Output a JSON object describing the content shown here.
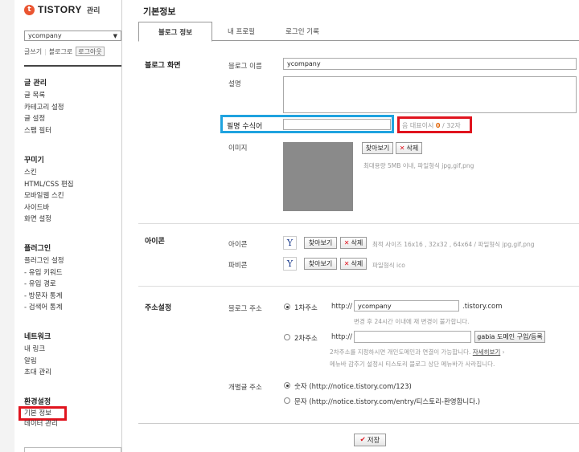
{
  "sidebar": {
    "logo_mark": "t",
    "logo_text": "TISTORY",
    "logo_sub": "관리",
    "blog_select": "ycompany",
    "quick": {
      "write": "글쓰기",
      "blog": "블로그로",
      "logout": "로그아웃"
    },
    "groups": [
      {
        "title": "글 관리",
        "items": [
          "글 목록",
          "카테고리 설정",
          "글 설정",
          "스팸 필터"
        ]
      },
      {
        "title": "꾸미기",
        "items": [
          "스킨",
          "HTML/CSS 편집",
          "모바일웹 스킨",
          "사이드바",
          "화면 설정"
        ]
      },
      {
        "title": "플러그인",
        "items": [
          "플러그인 설정",
          "- 유입 키워드",
          "- 유입 경로",
          "- 방문자 통계",
          "- 검색어 통계"
        ]
      },
      {
        "title": "네트워크",
        "items": [
          "내 링크",
          "알림",
          "초대 관리"
        ]
      },
      {
        "title": "환경설정",
        "items": [
          "기본 정보",
          "데이터 관리"
        ]
      }
    ]
  },
  "main": {
    "title": "기본정보",
    "tabs": [
      "블로그 정보",
      "내 프로필",
      "로그인 기록"
    ],
    "blog_screen": {
      "section": "블로그 화면",
      "name_label": "블로그 이름",
      "name_value": "ycompany",
      "desc_label": "설명",
      "desc_value": "",
      "nickname_label": "필명 수식어",
      "nickname_value": "",
      "counter_prefix": "음 대표이시",
      "counter_value": "0",
      "counter_suffix": " / 32자",
      "image_label": "이미지",
      "find_button": "찾아보기",
      "delete_button": "삭제",
      "image_hint": "최대용량 5MB 이내, 파일형식 jpg,gif,png"
    },
    "icon": {
      "section": "아이콘",
      "icon_label": "아이콘",
      "favicon_label": "파비콘",
      "icon_glyph": "Y",
      "find_button": "찾아보기",
      "delete_button": "삭제",
      "icon_hint": "최적 사이즈 16x16 , 32x32 , 64x64 / 파일형식 jpg,gif,png",
      "favicon_hint": "파일형식 ico"
    },
    "address": {
      "section": "주소설정",
      "blog_address_label": "블로그 주소",
      "primary_label": "1차주소",
      "http_prefix": "http://",
      "primary_value": "ycompany",
      "domain_suffix": ".tistory.com",
      "primary_hint": "변경 후 24시간 이내에 재 변경이 불가합니다.",
      "secondary_label": "2차주소",
      "secondary_value": "",
      "gabia_button": "gabia 도메인 구입/등록",
      "secondary_hint_1": "2차주소를 지정하시면 개인도메인과 연결이 가능합니다.",
      "secondary_hint_link": "자세히보기",
      "secondary_hint_2": "메뉴바 감추기 설정시 티스토리 블로그 상단 메뉴바가 사라집니다.",
      "post_address_label": "개별글 주소",
      "opt_number": "숫자 (http://notice.tistory.com/123)",
      "opt_text": "문자 (http://notice.tistory.com/entry/티스토리-환영합니다.)"
    },
    "save_label": "저장"
  }
}
